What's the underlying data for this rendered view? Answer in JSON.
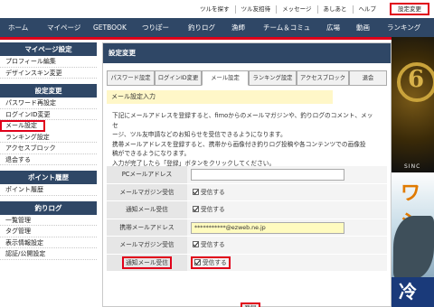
{
  "util_links": [
    "ツルを探す",
    "ツル友招待",
    "メッセージ",
    "あしあと",
    "ヘルプ"
  ],
  "util_settings_button": "設定変更",
  "nav_items": [
    "ホーム",
    "マイページ",
    "GETBOOK",
    "つりぽー",
    "釣りログ",
    "漁師",
    "チーム＆コミュ",
    "広場",
    "動画",
    "ランキング"
  ],
  "sidebar": {
    "sections": [
      {
        "title": "マイページ設定",
        "items": [
          "プロフィール編集",
          "デザインスキン変更"
        ]
      },
      {
        "title": "設定変更",
        "items": [
          "パスワード再設定",
          "ログインID変更",
          "メール設定",
          "ランキング設定",
          "アクセスブロック",
          "退会する"
        ]
      },
      {
        "title": "ポイント履歴",
        "items": [
          "ポイント履歴"
        ]
      },
      {
        "title": "釣りログ",
        "items": [
          "一覧管理",
          "タグ管理",
          "表示情報設定",
          "認証/公開設定"
        ]
      }
    ]
  },
  "main": {
    "title": "設定変更",
    "tabs": [
      "パスワード設定",
      "ログインID変更",
      "メール設定",
      "ランキング設定",
      "アクセスブロック",
      "退会"
    ],
    "active_tab": "メール設定",
    "section_label": "メール設定入力",
    "description": [
      "下記にメールアドレスを登録すると、fimoからのメールマガジンや、釣りログのコメント、メッセ",
      "ージ、ツル友申請などのお知らせを受信できるようになります。",
      "携帯メールアドレスを登録すると、携帯から画像付き釣りログ投稿や各コンテンツでの画像投",
      "稿ができるようになります。",
      "入力が完了したら「登録」ボタンをクリックしてください。"
    ],
    "rows": [
      {
        "label": "PCメールアドレス",
        "type": "input",
        "value": ""
      },
      {
        "label": "メールマガジン受信",
        "type": "checkbox",
        "text": "受信する",
        "checked": true
      },
      {
        "label": "通知メール受信",
        "type": "checkbox",
        "text": "受信する",
        "checked": true
      },
      {
        "label": "携帯メールアドレス",
        "type": "input",
        "value": "***********@ezweb.ne.jp"
      },
      {
        "label": "メールマガジン受信",
        "type": "checkbox",
        "text": "受信する",
        "checked": true
      },
      {
        "label": "通知メール受信",
        "type": "checkbox",
        "text": "受信する",
        "checked": true
      }
    ],
    "register_button": "登録"
  },
  "banner": {
    "top_text": "6",
    "top_caption": "SINC",
    "mid_text": "ワシ",
    "bottom_text": "冷 音"
  },
  "colors": {
    "nav": "#2f4766",
    "highlight": "#e0001a",
    "section_label_bg": "#fff7c8"
  }
}
